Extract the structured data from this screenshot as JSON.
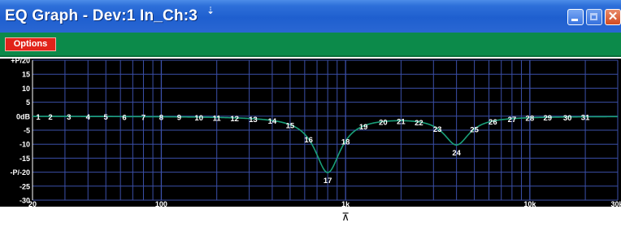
{
  "window": {
    "title": "EQ Graph - Dev:1 In_Ch:3",
    "close_glyph": "✕"
  },
  "menu": {
    "options_label": "Options"
  },
  "colors": {
    "title_bar": "#2d6fd9",
    "menu_bar": "#0c8a4a",
    "options_button": "#e2231a",
    "plot_bg": "#000000",
    "grid": "#3b4fa8",
    "curve": "#1aa07a",
    "labels": "#ffffff"
  },
  "chart_data": {
    "type": "line",
    "xscale": "log",
    "xlim": [
      20,
      30000
    ],
    "ylim": [
      -30,
      20
    ],
    "grid": true,
    "y_tick_labels": [
      "+P/20",
      "15",
      "10",
      "5",
      "0dB",
      "-5",
      "-10",
      "-15",
      "-P/-20",
      "-25",
      "-30"
    ],
    "x_tick_labels": [
      "20",
      "100",
      "1k",
      "10k",
      "30k"
    ],
    "band_labels": [
      "1",
      "2",
      "3",
      "4",
      "5",
      "6",
      "7",
      "8",
      "9",
      "10",
      "11",
      "12",
      "13",
      "14",
      "15",
      "16",
      "17",
      "18",
      "19",
      "20",
      "21",
      "22",
      "23",
      "24",
      "25",
      "26",
      "27",
      "28",
      "29",
      "30",
      "31"
    ],
    "band_centers": [
      20,
      25,
      31.5,
      40,
      50,
      63,
      80,
      100,
      125,
      160,
      200,
      250,
      315,
      400,
      500,
      630,
      800,
      1000,
      1250,
      1600,
      2000,
      2500,
      3150,
      4000,
      5000,
      6300,
      8000,
      10000,
      12500,
      16000,
      20000
    ],
    "band_gains": [
      0,
      0,
      0,
      0,
      0,
      0,
      0,
      0,
      0,
      0,
      0,
      0,
      0,
      0,
      0,
      0,
      -20,
      0,
      0,
      0,
      0,
      0,
      0,
      -10,
      0,
      0,
      0,
      0,
      0,
      0,
      0
    ],
    "marker_glyph": "⊼"
  }
}
